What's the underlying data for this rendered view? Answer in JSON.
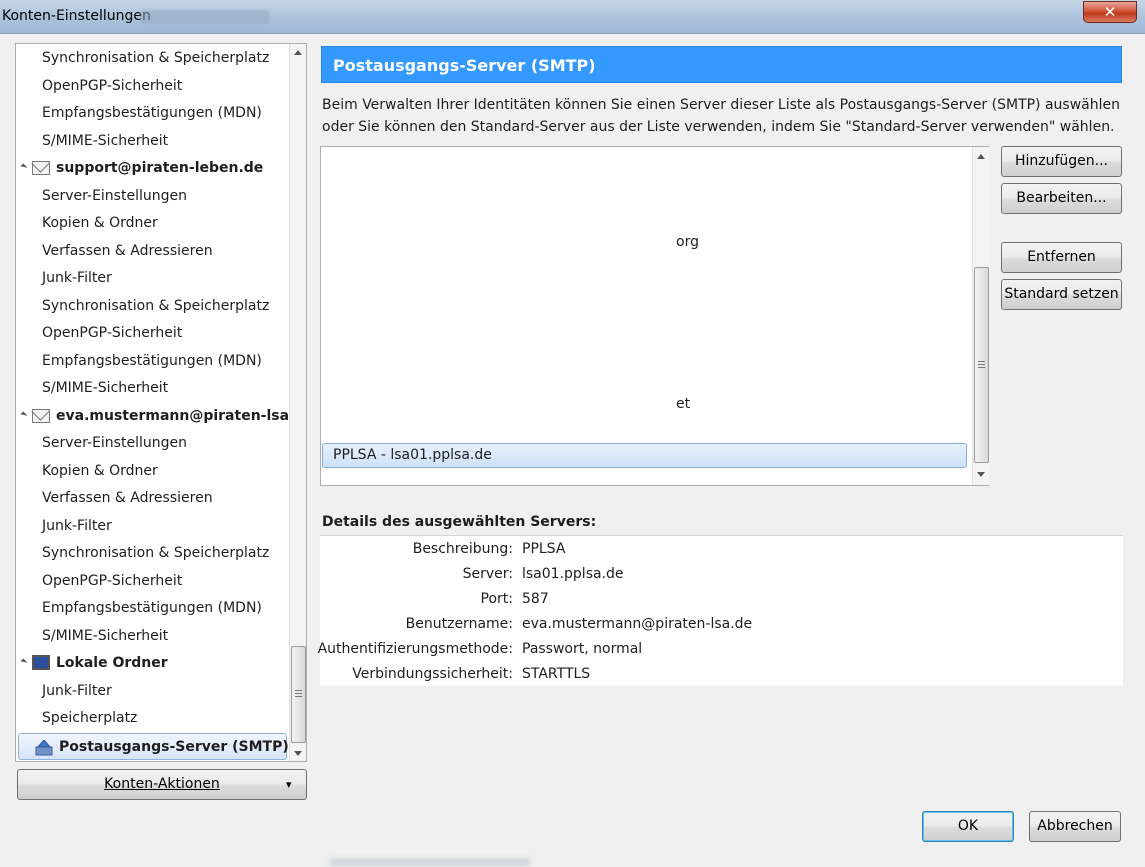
{
  "window": {
    "title": "Konten-Einstellungen",
    "close_label": "✕"
  },
  "tree": {
    "items": [
      {
        "label": "Synchronisation & Speicherplatz",
        "kind": "child"
      },
      {
        "label": "OpenPGP-Sicherheit",
        "kind": "child"
      },
      {
        "label": "Empfangsbestätigungen (MDN)",
        "kind": "child"
      },
      {
        "label": "S/MIME-Sicherheit",
        "kind": "child"
      },
      {
        "label": "support@piraten-leben.de",
        "kind": "account"
      },
      {
        "label": "Server-Einstellungen",
        "kind": "child"
      },
      {
        "label": "Kopien & Ordner",
        "kind": "child"
      },
      {
        "label": "Verfassen & Adressieren",
        "kind": "child"
      },
      {
        "label": "Junk-Filter",
        "kind": "child"
      },
      {
        "label": "Synchronisation & Speicherplatz",
        "kind": "child"
      },
      {
        "label": "OpenPGP-Sicherheit",
        "kind": "child"
      },
      {
        "label": "Empfangsbestätigungen (MDN)",
        "kind": "child"
      },
      {
        "label": "S/MIME-Sicherheit",
        "kind": "child"
      },
      {
        "label": "eva.mustermann@piraten-lsa.de",
        "kind": "account"
      },
      {
        "label": "Server-Einstellungen",
        "kind": "child"
      },
      {
        "label": "Kopien & Ordner",
        "kind": "child"
      },
      {
        "label": "Verfassen & Adressieren",
        "kind": "child"
      },
      {
        "label": "Junk-Filter",
        "kind": "child"
      },
      {
        "label": "Synchronisation & Speicherplatz",
        "kind": "child"
      },
      {
        "label": "OpenPGP-Sicherheit",
        "kind": "child"
      },
      {
        "label": "Empfangsbestätigungen (MDN)",
        "kind": "child"
      },
      {
        "label": "S/MIME-Sicherheit",
        "kind": "child"
      },
      {
        "label": "Lokale Ordner",
        "kind": "local"
      },
      {
        "label": "Junk-Filter",
        "kind": "child"
      },
      {
        "label": "Speicherplatz",
        "kind": "child"
      },
      {
        "label": "Postausgangs-Server (SMTP)",
        "kind": "smtp",
        "selected": true
      }
    ]
  },
  "account_actions": {
    "label": "Konten-Aktionen",
    "arrow": "▾"
  },
  "main": {
    "header": "Postausgangs-Server (SMTP)",
    "description": "Beim Verwalten Ihrer Identitäten können Sie einen Server dieser Liste als Postausgangs-Server (SMTP) auswählen oder Sie können den Standard-Server aus der Liste verwenden, indem Sie \"Standard-Server verwenden\" wählen.",
    "server_list": {
      "fragments": [
        "org",
        "et"
      ],
      "selected": "PPLSA - lsa01.pplsa.de"
    },
    "buttons": {
      "add": "Hinzufügen...",
      "edit": "Bearbeiten...",
      "remove": "Entfernen",
      "set_default": "Standard setzen"
    },
    "details": {
      "title": "Details des ausgewählten Servers:",
      "rows": [
        {
          "key": "Beschreibung:",
          "value": "PPLSA"
        },
        {
          "key": "Server:",
          "value": "lsa01.pplsa.de"
        },
        {
          "key": "Port:",
          "value": "587"
        },
        {
          "key": "Benutzername:",
          "value": "eva.mustermann@piraten-lsa.de"
        },
        {
          "key": "Authentifizierungsmethode:",
          "value": "Passwort, normal"
        },
        {
          "key": "Verbindungssicherheit:",
          "value": "STARTTLS"
        }
      ]
    }
  },
  "footer": {
    "ok": "OK",
    "cancel": "Abbrechen"
  },
  "colors": {
    "header_blue": "#3399ff",
    "selection": "#cde1f9"
  }
}
